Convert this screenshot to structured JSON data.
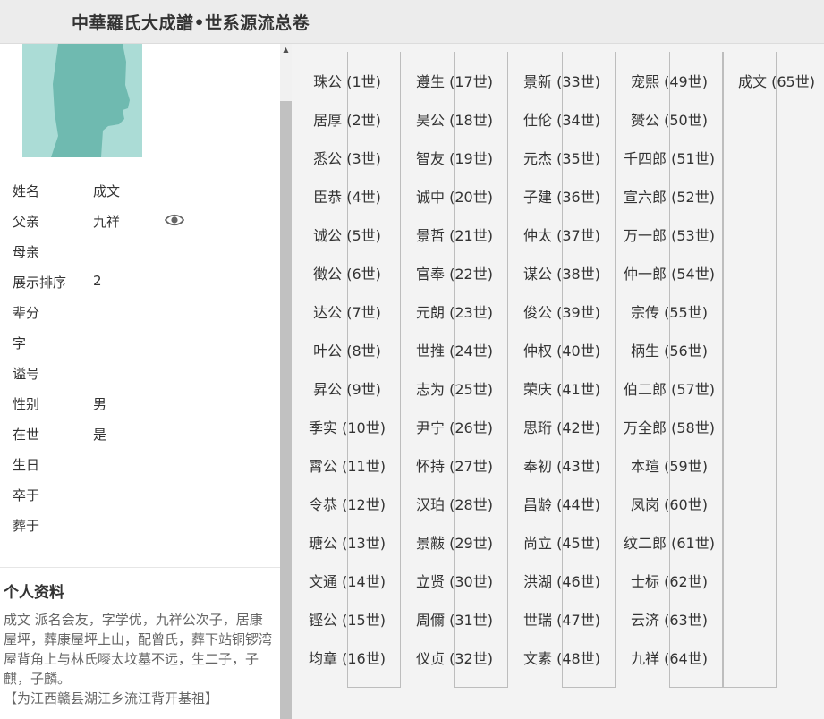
{
  "header": {
    "title": "中華羅氏大成譜•世系源流总卷"
  },
  "person": {
    "fields": [
      {
        "label": "姓名",
        "value": "成文"
      },
      {
        "label": "父亲",
        "value": "九祥"
      },
      {
        "label": "母亲",
        "value": ""
      },
      {
        "label": "展示排序",
        "value": "2"
      },
      {
        "label": "辈分",
        "value": ""
      },
      {
        "label": "字",
        "value": ""
      },
      {
        "label": "谥号",
        "value": ""
      },
      {
        "label": "性别",
        "value": "男"
      },
      {
        "label": "在世",
        "value": "是"
      },
      {
        "label": "生日",
        "value": ""
      },
      {
        "label": "卒于",
        "value": ""
      },
      {
        "label": "葬于",
        "value": ""
      }
    ]
  },
  "profile": {
    "title": "个人资料",
    "bio": "成文 派名会友，字学优，九祥公次子，居康屋坪，葬康屋坪上山，配曾氏，葬下站铜锣湾屋背角上与林氏嘜太坟墓不远，生二子，子麒，子麟。",
    "note": "【为江西赣县湖江乡流江背开基祖】"
  },
  "lineage": {
    "columns": [
      [
        "珠公 (1世)",
        "居厚 (2世)",
        "悉公 (3世)",
        "臣恭 (4世)",
        "诚公 (5世)",
        "徵公 (6世)",
        "达公 (7世)",
        "叶公 (8世)",
        "昇公 (9世)",
        "季实 (10世)",
        "霄公 (11世)",
        "令恭 (12世)",
        "瑭公 (13世)",
        "文通 (14世)",
        "铿公 (15世)",
        "均章 (16世)"
      ],
      [
        "遵生 (17世)",
        "昊公 (18世)",
        "智友 (19世)",
        "诚中 (20世)",
        "景哲 (21世)",
        "官奉 (22世)",
        "元朗 (23世)",
        "世推 (24世)",
        "志为 (25世)",
        "尹宁 (26世)",
        "怀持 (27世)",
        "汉珀 (28世)",
        "景黻 (29世)",
        "立贤 (30世)",
        "周儞 (31世)",
        "仪贞 (32世)"
      ],
      [
        "景新 (33世)",
        "仕伦 (34世)",
        "元杰 (35世)",
        "子建 (36世)",
        "仲太 (37世)",
        "谋公 (38世)",
        "俊公 (39世)",
        "仲权 (40世)",
        "荣庆 (41世)",
        "思珩 (42世)",
        "奉初 (43世)",
        "昌龄 (44世)",
        "尚立 (45世)",
        "洪湖 (46世)",
        "世瑞 (47世)",
        "文素 (48世)"
      ],
      [
        "宠熙 (49世)",
        "赟公 (50世)",
        "千四郎 (51世)",
        "宣六郎 (52世)",
        "万一郎 (53世)",
        "仲一郎 (54世)",
        "宗传 (55世)",
        "柄生 (56世)",
        "伯二郎 (57世)",
        "万全郎 (58世)",
        "本瑄 (59世)",
        "凤岗 (60世)",
        "纹二郎 (61世)",
        "士标 (62世)",
        "云济 (63世)",
        "九祥 (64世)"
      ],
      [
        "成文 (65世)"
      ]
    ]
  }
}
